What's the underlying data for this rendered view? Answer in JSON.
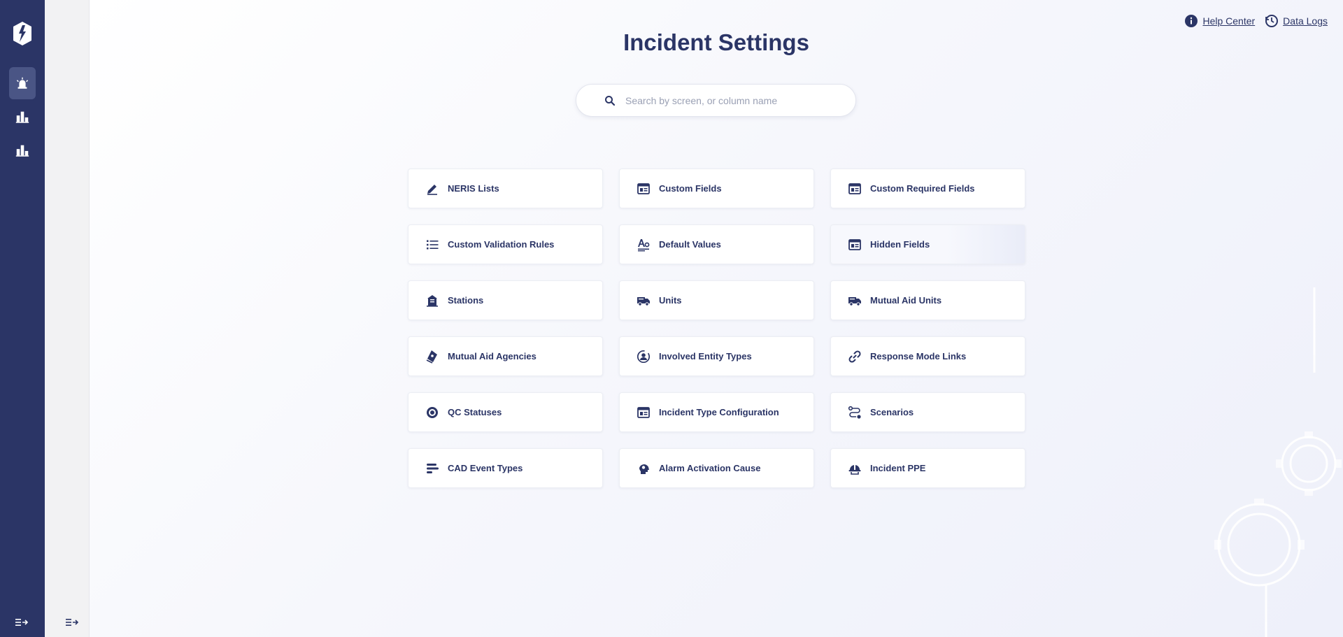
{
  "page": {
    "title": "Incident Settings"
  },
  "header_links": {
    "help_center": "Help Center",
    "data_logs": "Data Logs"
  },
  "search": {
    "placeholder": "Search by screen, or column name",
    "value": ""
  },
  "nav_rail": {
    "items": [
      {
        "icon": "fire-alarm-icon",
        "active": true
      },
      {
        "icon": "bar-chart-icon",
        "active": false
      },
      {
        "icon": "bar-chart-icon",
        "active": false
      }
    ]
  },
  "settings_cards": [
    {
      "label": "NERIS Lists",
      "icon": "pencil-icon"
    },
    {
      "label": "Custom Fields",
      "icon": "form-icon"
    },
    {
      "label": "Custom Required Fields",
      "icon": "form-icon"
    },
    {
      "label": "Custom Validation Rules",
      "icon": "list-icon"
    },
    {
      "label": "Default Values",
      "icon": "text-format-icon"
    },
    {
      "label": "Hidden Fields",
      "icon": "form-icon"
    },
    {
      "label": "Stations",
      "icon": "station-icon"
    },
    {
      "label": "Units",
      "icon": "truck-icon"
    },
    {
      "label": "Mutual Aid Units",
      "icon": "truck-icon"
    },
    {
      "label": "Mutual Aid Agencies",
      "icon": "badge-icon"
    },
    {
      "label": "Involved Entity Types",
      "icon": "person-circle-icon"
    },
    {
      "label": "Response Mode Links",
      "icon": "link-icon"
    },
    {
      "label": "QC Statuses",
      "icon": "target-icon"
    },
    {
      "label": "Incident Type Configuration",
      "icon": "form-icon"
    },
    {
      "label": "Scenarios",
      "icon": "route-icon"
    },
    {
      "label": "CAD Event Types",
      "icon": "align-left-icon"
    },
    {
      "label": "Alarm Activation Cause",
      "icon": "head-gear-icon"
    },
    {
      "label": "Incident PPE",
      "icon": "helmet-icon"
    }
  ],
  "colors": {
    "nav_rail": "#2b3566",
    "accent_text": "#2b3566",
    "subpane": "#f2f2f3"
  }
}
